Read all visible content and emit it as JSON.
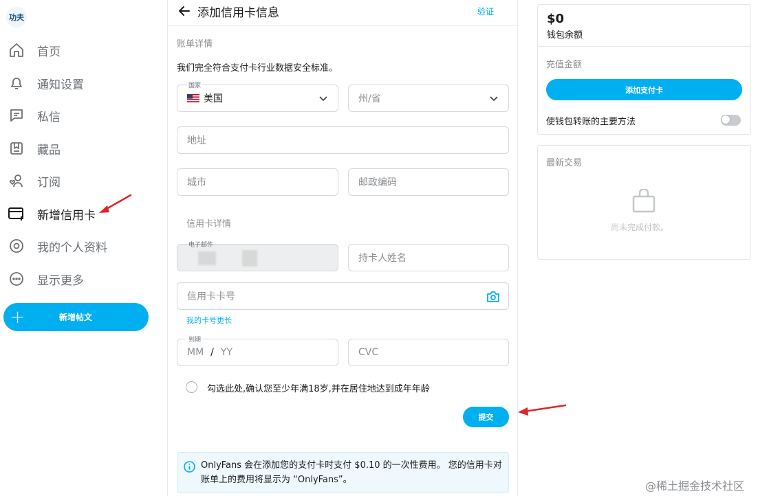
{
  "sidebar": {
    "avatar_text": "功夫",
    "items": [
      {
        "label": "首页",
        "icon": "home-icon"
      },
      {
        "label": "通知设置",
        "icon": "bell-icon"
      },
      {
        "label": "私信",
        "icon": "message-icon"
      },
      {
        "label": "藏品",
        "icon": "bookmark-icon"
      },
      {
        "label": "订阅",
        "icon": "subscriptions-icon"
      },
      {
        "label": "新增信用卡",
        "icon": "add-card-icon",
        "active": true
      },
      {
        "label": "我的个人资料",
        "icon": "profile-icon"
      },
      {
        "label": "显示更多",
        "icon": "more-icon"
      }
    ],
    "new_post_label": "新增帖文"
  },
  "header": {
    "title": "添加信用卡信息",
    "verify_label": "验证"
  },
  "billing": {
    "section_label": "账单详情",
    "compliance_text": "我们完全符合支付卡行业数据安全标准。",
    "country_label": "国家",
    "country_value": "美国",
    "state_placeholder": "州/省",
    "address_placeholder": "地址",
    "city_placeholder": "城市",
    "zip_placeholder": "邮政编码"
  },
  "card": {
    "section_label": "信用卡详情",
    "email_label": "电子邮件",
    "holder_placeholder": "持卡人姓名",
    "number_placeholder": "信用卡卡号",
    "longer_link": "我的卡号更长",
    "expiry_label": "到期",
    "expiry_mm": "MM",
    "expiry_sep": "/",
    "expiry_yy": "YY",
    "cvc_placeholder": "CVC",
    "age_confirm": "勾选此处,确认您至少年满18岁,并在居住地达到成年年龄",
    "submit_label": "提交"
  },
  "notice": {
    "text": "OnlyFans 会在添加您的支付卡时支付 $0.10 的一次性费用。 您的信用卡对账单上的费用将显示为 “OnlyFans”。"
  },
  "wallet": {
    "balance": "$0",
    "balance_label": "钱包余额",
    "topup_label": "充值金额",
    "add_card_label": "添加支付卡",
    "primary_method_label": "使钱包转账的主要方法",
    "primary_method_enabled": false
  },
  "transactions": {
    "title": "最新交易",
    "empty_text": "尚未完成付款。"
  },
  "watermark": "@稀土掘金技术社区",
  "colors": {
    "accent": "#00aff0",
    "arrow": "#e0242a"
  }
}
